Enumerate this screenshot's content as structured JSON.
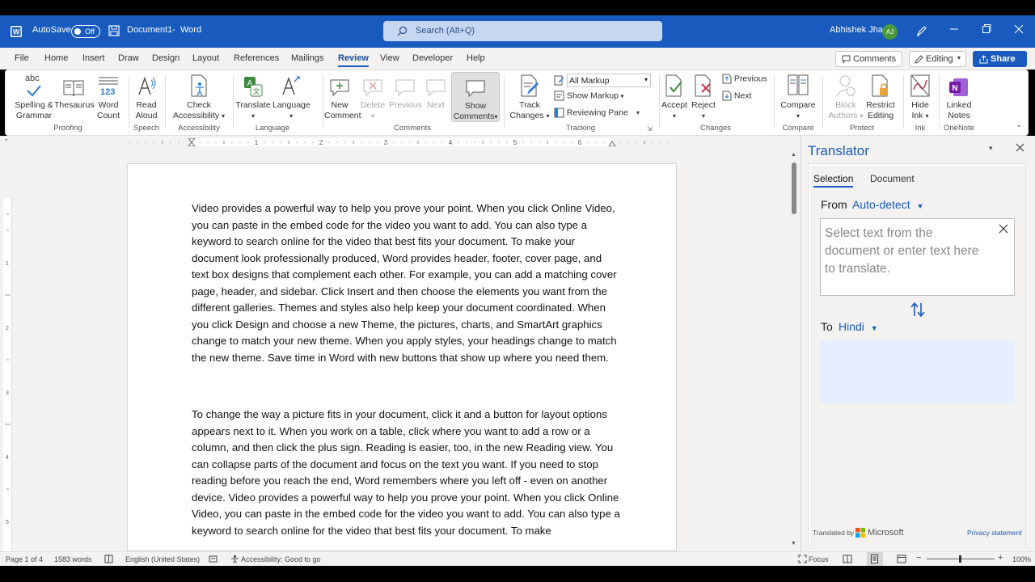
{
  "titlebar": {
    "autosave_label": "AutoSave",
    "autosave_state": "Off",
    "doc_name": "Document1",
    "separator": "-",
    "app_name": "Word",
    "search_placeholder": "Search (Alt+Q)",
    "user_name": "Abhishek Jha",
    "user_initials": "AJ"
  },
  "menu": {
    "tabs": [
      "File",
      "Home",
      "Insert",
      "Draw",
      "Design",
      "Layout",
      "References",
      "Mailings",
      "Review",
      "View",
      "Developer",
      "Help"
    ],
    "active_tab": "Review",
    "comments_btn": "Comments",
    "editing_btn": "Editing",
    "share_btn": "Share"
  },
  "ribbon": {
    "proofing": {
      "spelling": "Spelling &",
      "spelling2": "Grammar",
      "thesaurus": "Thesaurus",
      "wordcount": "Word",
      "wordcount2": "Count",
      "group": "Proofing",
      "abc": "abc",
      "n123": "123"
    },
    "speech": {
      "read": "Read",
      "read2": "Aloud",
      "group": "Speech"
    },
    "accessibility": {
      "check": "Check",
      "check2": "Accessibility",
      "group": "Accessibility"
    },
    "language": {
      "translate": "Translate",
      "language": "Language",
      "group": "Language"
    },
    "comments": {
      "new": "New",
      "new2": "Comment",
      "delete": "Delete",
      "previous": "Previous",
      "next": "Next",
      "show": "Show",
      "show2": "Comments",
      "group": "Comments"
    },
    "tracking": {
      "track": "Track",
      "track2": "Changes",
      "markup_select": "All Markup",
      "show_markup": "Show Markup",
      "reviewing_pane": "Reviewing Pane",
      "group": "Tracking"
    },
    "changes": {
      "accept": "Accept",
      "reject": "Reject",
      "previous": "Previous",
      "next": "Next",
      "group": "Changes"
    },
    "compare": {
      "compare": "Compare",
      "group": "Compare"
    },
    "protect": {
      "block": "Block",
      "block2": "Authors",
      "restrict": "Restrict",
      "restrict2": "Editing",
      "group": "Protect"
    },
    "ink": {
      "hide": "Hide",
      "hide2": "Ink",
      "group": "Ink"
    },
    "onenote": {
      "linked": "Linked",
      "linked2": "Notes",
      "group": "OneNote"
    }
  },
  "document": {
    "paragraphs": [
      "Video provides a powerful way to help you prove your point. When you click Online Video, you can paste in the embed code for the video you want to add. You can also type a keyword to search online for the video that best fits your document. To make your document look professionally produced, Word provides header, footer, cover page, and text box designs that complement each other. For example, you can add a matching cover page, header, and sidebar. Click Insert and then choose the elements you want from the different galleries. Themes and styles also help keep your document coordinated. When you click Design and choose a new Theme, the pictures, charts, and SmartArt graphics change to match your new theme. When you apply styles, your headings change to match the new theme. Save time in Word with new buttons that show up where you need them.",
      "To change the way a picture fits in your document, click it and a button for layout options appears next to it. When you work on a table, click where you want to add a row or a column, and then click the plus sign. Reading is easier, too, in the new Reading view. You can collapse parts of the document and focus on the text you want. If you need to stop reading before you reach the end, Word remembers where you left off - even on another device. Video provides a powerful way to help you prove your point. When you click Online Video, you can paste in the embed code for the video you want to add. You can also type a keyword to search online for the video that best fits your document. To make"
    ]
  },
  "translator": {
    "title": "Translator",
    "tab_selection": "Selection",
    "tab_document": "Document",
    "from_label": "From",
    "from_value": "Auto-detect",
    "input_placeholder": "Select text from the document or enter text here to translate.",
    "to_label": "To",
    "to_value": "Hindi",
    "translated_by": "Translated by",
    "provider": "Microsoft",
    "privacy": "Privacy statement"
  },
  "status": {
    "page": "Page 1 of 4",
    "words": "1583 words",
    "language": "English (United States)",
    "accessibility": "Accessibility: Good to go",
    "focus": "Focus",
    "zoom": "100%"
  },
  "colors": {
    "brand": "#185abd",
    "pane_bg": "#f3f2f1"
  }
}
